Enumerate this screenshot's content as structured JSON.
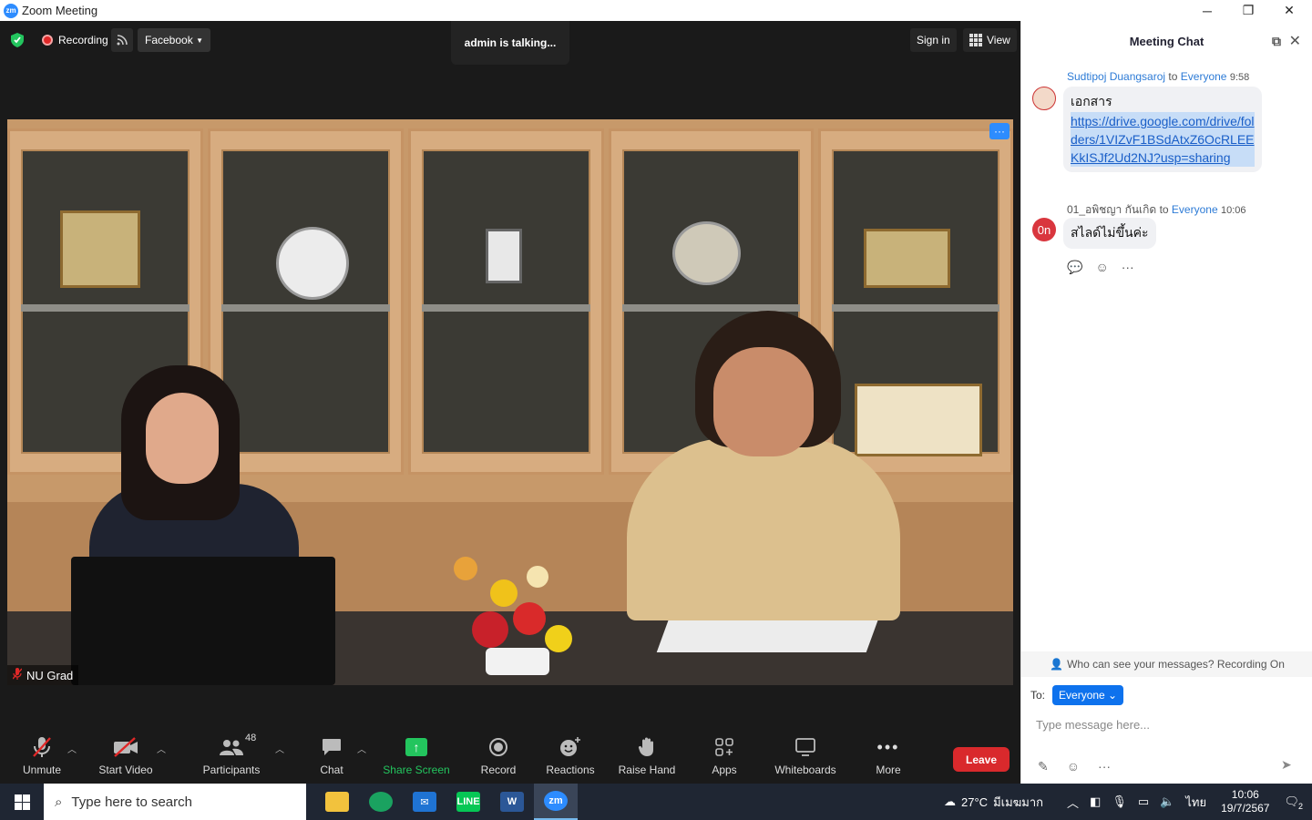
{
  "window": {
    "title": "Zoom Meeting",
    "app_icon": "zm",
    "controls": {
      "minimize": "─",
      "restore": "❐",
      "close": "✕"
    }
  },
  "topbar": {
    "recording_label": "Recording",
    "stream_label": "Facebook",
    "talking_label": "admin is talking...",
    "signin_label": "Sign in",
    "view_label": "View"
  },
  "video": {
    "participant_name": "NU Grad",
    "more_options": "···"
  },
  "toolbar": {
    "unmute": "Unmute",
    "start_video": "Start Video",
    "participants": "Participants",
    "participants_count": "48",
    "chat": "Chat",
    "share_screen": "Share Screen",
    "record": "Record",
    "reactions": "Reactions",
    "raise_hand": "Raise Hand",
    "apps": "Apps",
    "whiteboards": "Whiteboards",
    "more": "More",
    "leave": "Leave"
  },
  "chat": {
    "title": "Meeting Chat",
    "messages": [
      {
        "sender": "Sudtipoj Duangsaroj",
        "to_word": "to",
        "recipient": "Everyone",
        "time": "9:58",
        "text": "เอกสาร",
        "link": "https://drive.google.com/drive/folders/1VIZvF1BSdAtxZ6OcRLEEKkISJf2Ud2NJ?usp=sharing"
      },
      {
        "sender": "01_อพิชญา กันเกิด",
        "avatar_initials": "0n",
        "to_word": "to",
        "recipient": "Everyone",
        "time": "10:06",
        "text": "สไลด์ไม่ขึ้นค่ะ"
      }
    ],
    "visibility_note": "Who can see your messages? Recording On",
    "to_label": "To:",
    "to_value": "Everyone",
    "input_placeholder": "Type message here..."
  },
  "taskbar": {
    "search_placeholder": "Type here to search",
    "weather": "27°C",
    "weather_desc": "มีเมฆมาก",
    "language": "ไทย",
    "time": "10:06",
    "date": "19/7/2567",
    "notification_count": "2",
    "apps": [
      "File Explorer",
      "Edge",
      "Mail",
      "LINE",
      "Word",
      "Zoom"
    ]
  },
  "colors": {
    "zoom_blue": "#2d8cff",
    "leave_red": "#d9292c",
    "share_green": "#23c55e",
    "link_blue": "#1a5fc8"
  }
}
